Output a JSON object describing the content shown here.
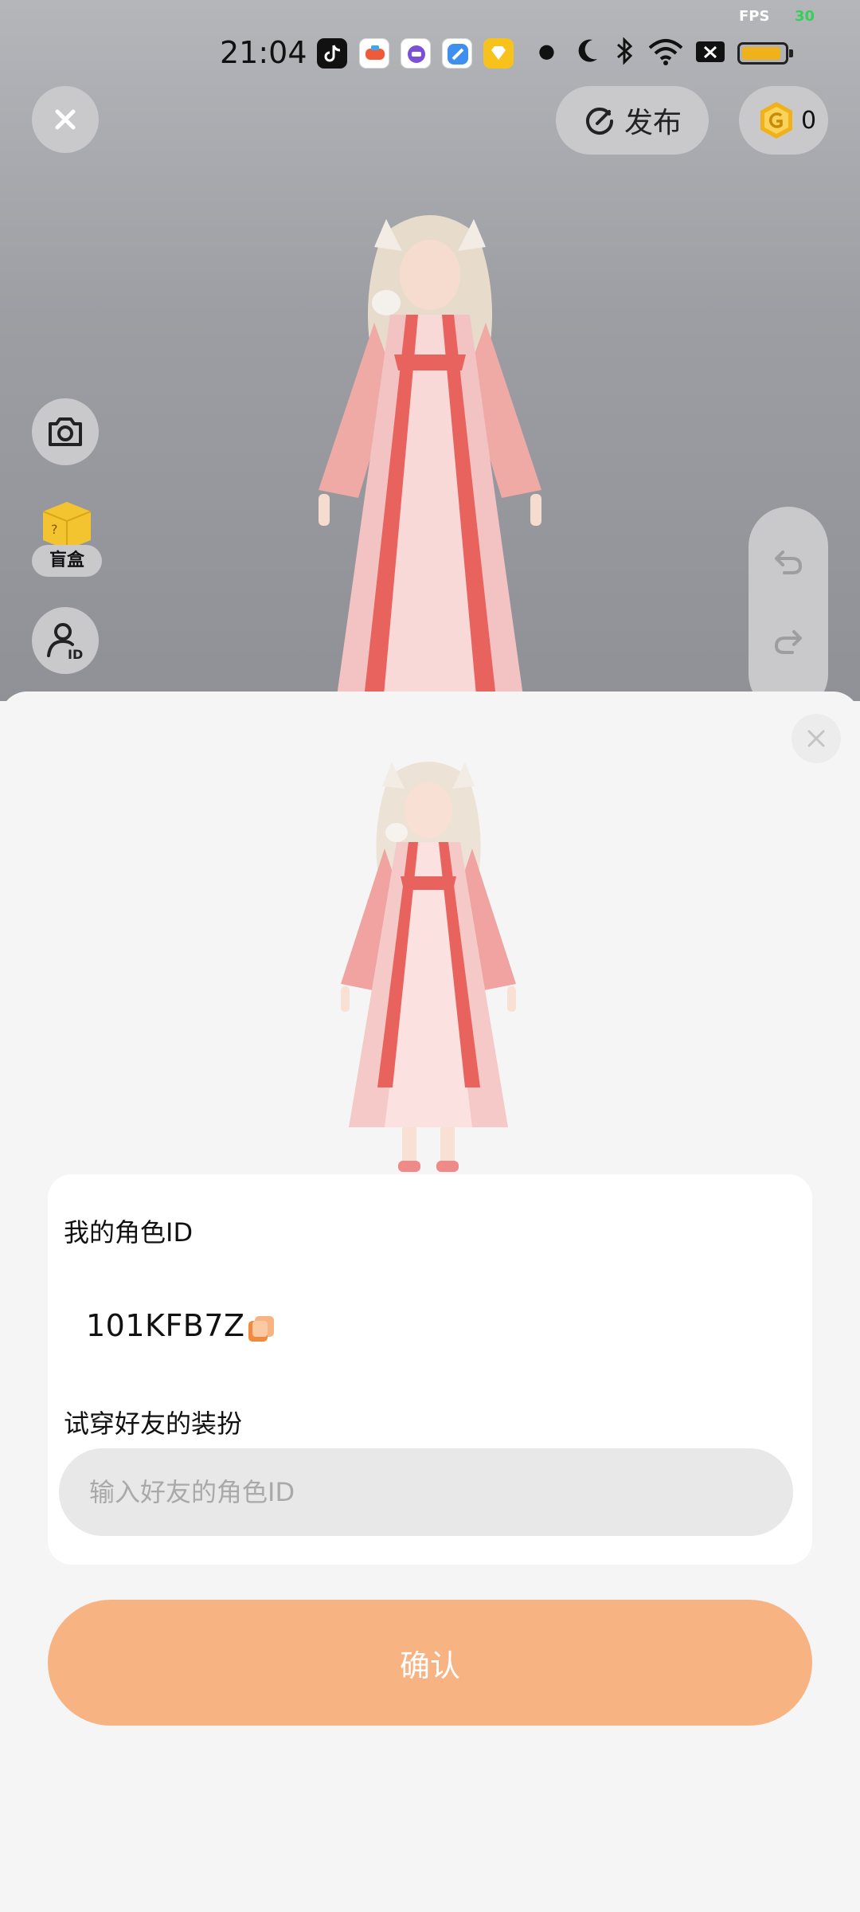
{
  "status_bar": {
    "fps_label": "FPS",
    "fps_value": "30",
    "time": "21:04",
    "app_icons": [
      "tiktok-icon",
      "game-center-icon",
      "purple-app-icon",
      "blue-app-icon",
      "yellow-app-icon"
    ],
    "status_icons": [
      "dot-icon",
      "moon-icon",
      "bluetooth-icon",
      "wifi-icon",
      "sim-off-icon",
      "battery-icon"
    ]
  },
  "toolbar": {
    "close_icon": "close-icon",
    "publish_label": "发布",
    "coin_count": "0"
  },
  "side_tools": {
    "camera_icon": "camera-icon",
    "blind_box_label": "盲盒",
    "character_id_icon": "person-id-icon"
  },
  "history": {
    "undo_icon": "undo-icon",
    "redo_icon": "redo-icon"
  },
  "sheet": {
    "my_id_label": "我的角色ID",
    "my_id_value": "101KFB7Z",
    "try_on_label": "试穿好友的装扮",
    "friend_id_placeholder": "输入好友的角色ID",
    "friend_id_value": "",
    "confirm_label": "确认"
  },
  "colors": {
    "accent": "#f8b382",
    "copy_icon": "#f08a3c",
    "coin_gold": "#f0b21b"
  }
}
